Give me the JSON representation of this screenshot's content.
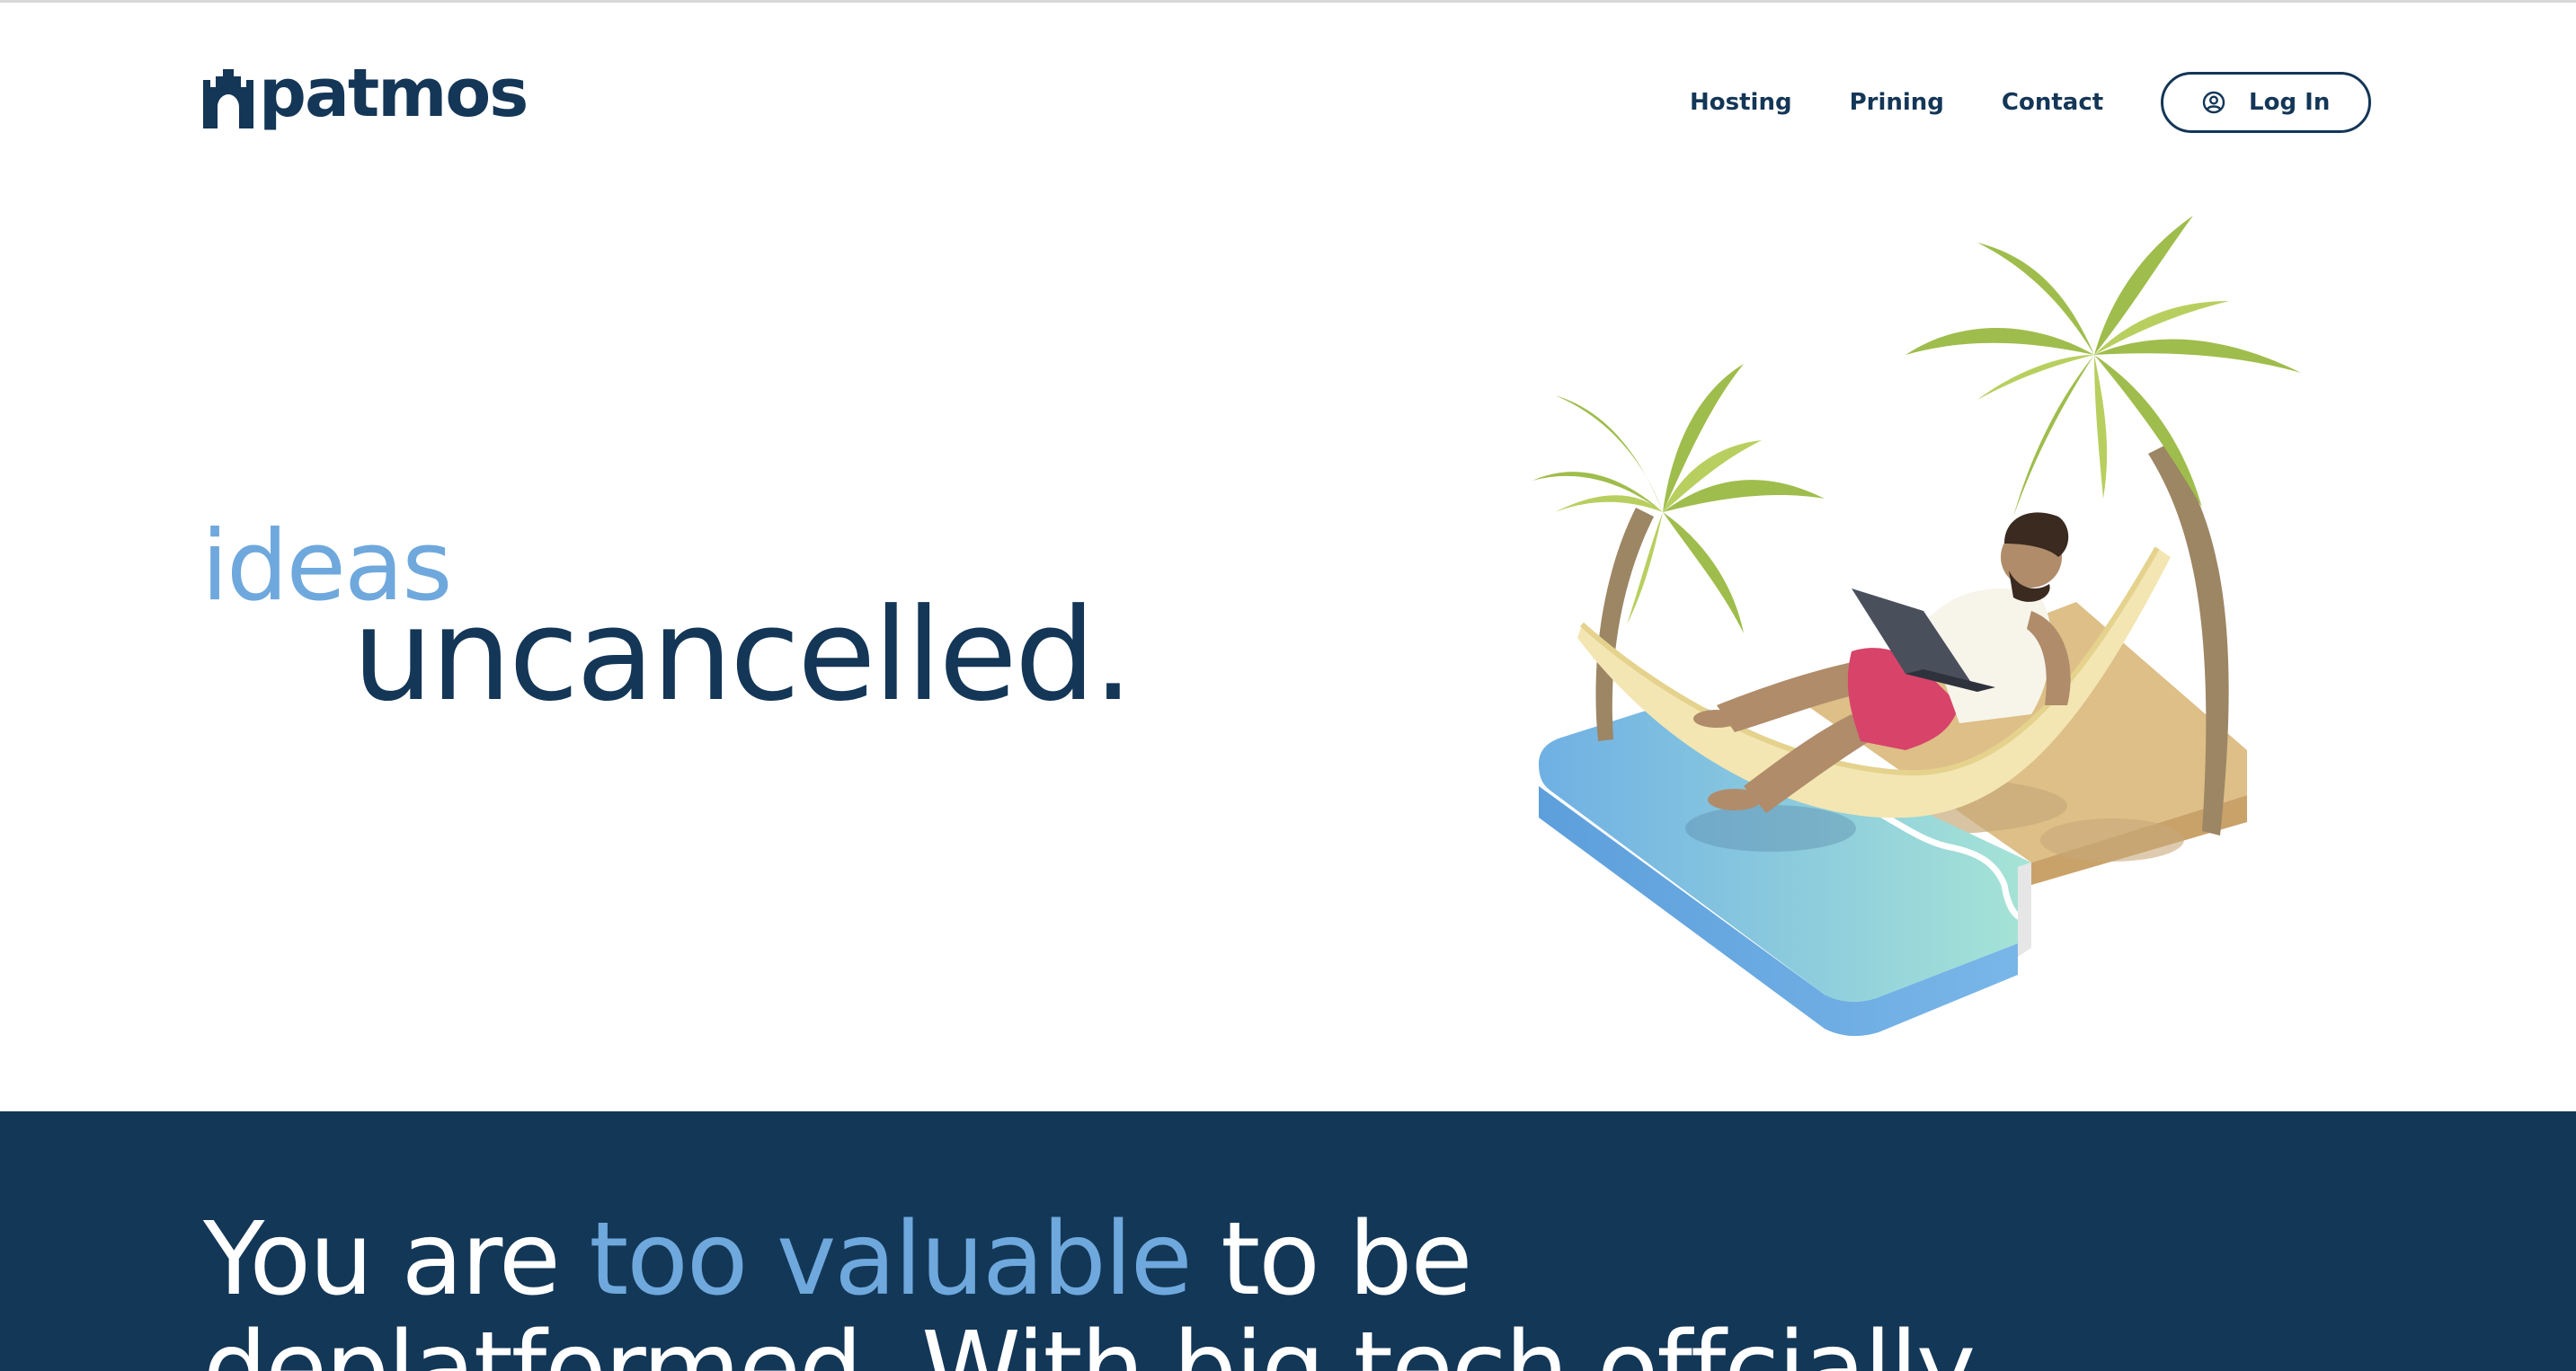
{
  "brand": {
    "name": "patmos",
    "primary_color": "#143657",
    "accent_color": "#6fa8dc",
    "logo_icon": "castle-gate-icon"
  },
  "nav": {
    "links": [
      {
        "label": "Hosting"
      },
      {
        "label": "Prining"
      },
      {
        "label": "Contact"
      }
    ],
    "login": {
      "label": "Log In",
      "icon": "user-circle-icon"
    }
  },
  "hero": {
    "word1": "ideas",
    "word2": "uncancelled.",
    "illustration": "man-in-hammock-on-beach-with-laptop"
  },
  "band": {
    "line1_prefix": "You are ",
    "line1_accent": "too valuable",
    "line1_suffix": " to be",
    "line2": "deplatformed. With big tech offcially",
    "background_color": "#133757"
  }
}
